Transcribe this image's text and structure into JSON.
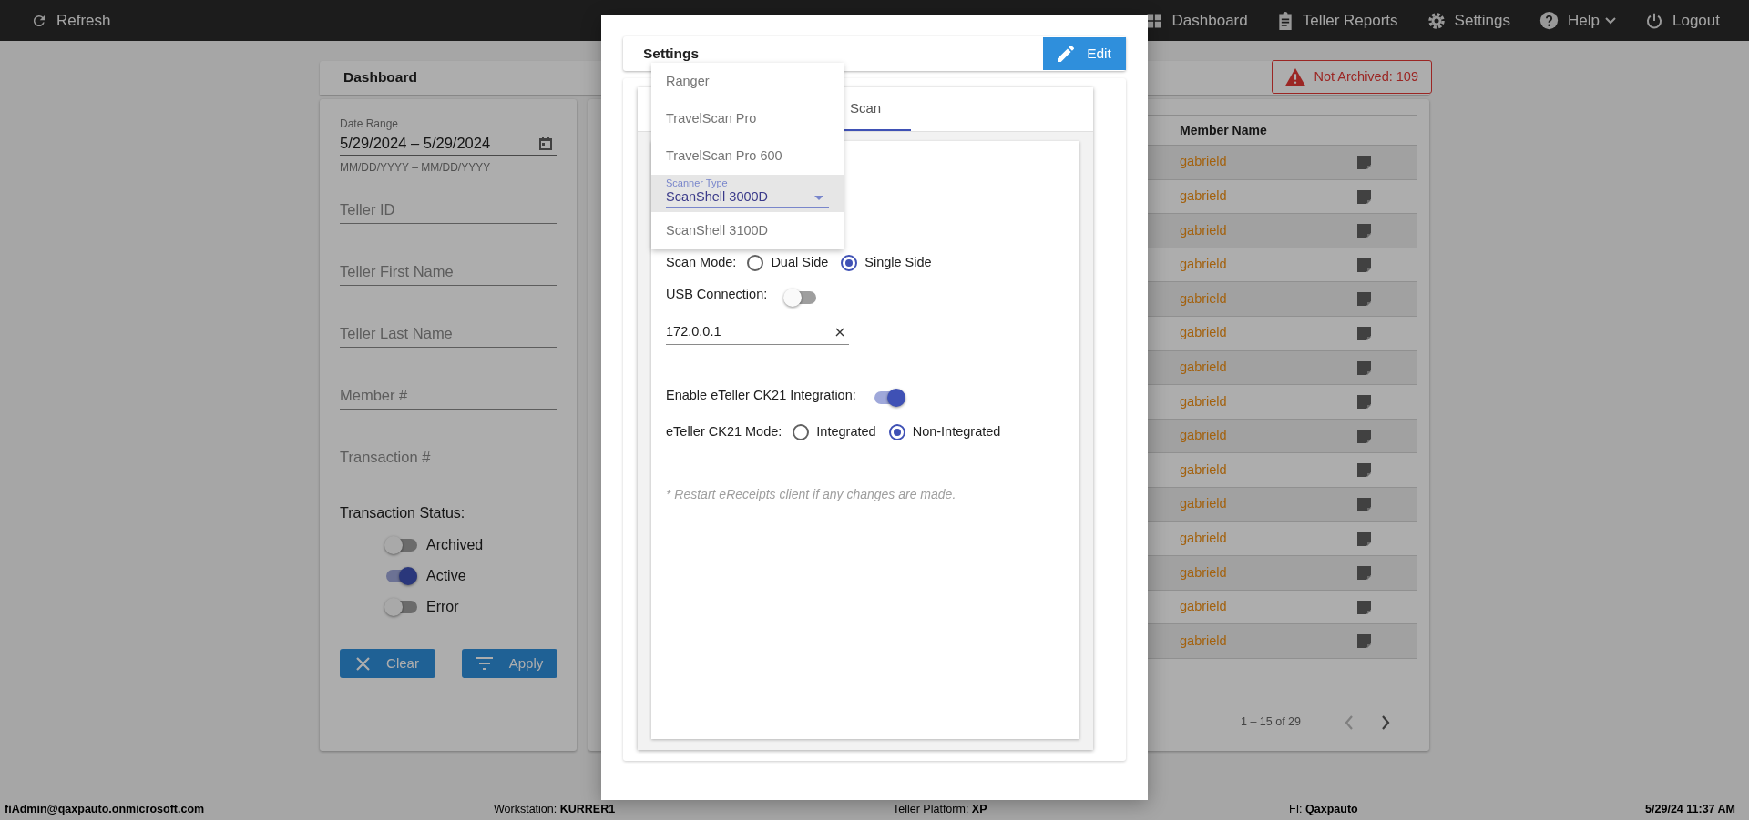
{
  "navbar": {
    "refresh": "Refresh",
    "items": [
      {
        "label": "Dashboard",
        "kind": "link"
      },
      {
        "label": "Teller Reports",
        "kind": "link"
      },
      {
        "label": "Settings",
        "kind": "link"
      },
      {
        "label": "Help",
        "kind": "menu"
      },
      {
        "label": "Logout",
        "kind": "link"
      }
    ]
  },
  "page": {
    "title": "Dashboard",
    "alert": "Not Archived: 109",
    "filters": {
      "date_range": {
        "label": "Date Range",
        "value": "5/29/2024 – 5/29/2024",
        "hint": "MM/DD/YYYY – MM/DD/YYYY"
      },
      "fields": [
        {
          "placeholder": "Teller ID"
        },
        {
          "placeholder": "Teller First Name"
        },
        {
          "placeholder": "Teller Last Name"
        },
        {
          "placeholder": "Member #"
        },
        {
          "placeholder": "Transaction #"
        }
      ],
      "status": {
        "label": "Transaction Status:",
        "toggles": [
          {
            "label": "Archived",
            "on": false
          },
          {
            "label": "Active",
            "on": true
          },
          {
            "label": "Error",
            "on": false
          }
        ]
      },
      "buttons": [
        {
          "label": "Clear",
          "kind": "clear"
        },
        {
          "label": "Apply",
          "kind": "apply"
        }
      ]
    },
    "table": {
      "columns": [
        "Member Name"
      ],
      "rows": [
        {
          "member_name": "gabrield"
        },
        {
          "member_name": "gabrield"
        },
        {
          "member_name": "gabrield"
        },
        {
          "member_name": "gabrield"
        },
        {
          "member_name": "gabrield"
        },
        {
          "member_name": "gabrield"
        },
        {
          "member_name": "gabrield"
        },
        {
          "member_name": "gabrield"
        },
        {
          "member_name": "gabrield"
        },
        {
          "member_name": "gabrield"
        },
        {
          "member_name": "gabrield"
        },
        {
          "member_name": "gabrield"
        },
        {
          "member_name": "gabrield"
        },
        {
          "member_name": "gabrield"
        },
        {
          "member_name": "gabrield"
        }
      ]
    },
    "pagination": {
      "range": "1 – 15 of 29"
    }
  },
  "modal": {
    "title": "Settings",
    "edit": "Edit",
    "tabs": [
      {
        "label": "Scan",
        "selected": true
      }
    ],
    "scanner": {
      "label": "Scanner Type",
      "options": [
        {
          "label": "Ranger",
          "selected": false
        },
        {
          "label": "TravelScan Pro",
          "selected": false
        },
        {
          "label": "TravelScan Pro 600",
          "selected": false
        },
        {
          "label": "ScanShell 3000D",
          "selected": true
        },
        {
          "label": "ScanShell 3100D",
          "selected": false
        }
      ]
    },
    "scan_mode": {
      "label": "Scan Mode:",
      "options": [
        {
          "label": "Dual Side",
          "selected": false
        },
        {
          "label": "Single Side",
          "selected": true
        }
      ]
    },
    "usb": {
      "label": "USB Connection:",
      "on": false
    },
    "host": {
      "value": "172.0.0.1"
    },
    "integration": {
      "label": "Enable eTeller CK21 Integration:",
      "on": true
    },
    "mode": {
      "label": "eTeller CK21 Mode:",
      "options": [
        {
          "label": "Integrated",
          "selected": false
        },
        {
          "label": "Non-Integrated",
          "selected": true
        }
      ]
    },
    "note": "* Restart eReceipts client if any changes are made."
  },
  "footer": {
    "user": "fiAdmin@qaxpauto.onmicrosoft.com",
    "workstation": "Workstation: **KURRER1**",
    "platform": "Teller Platform: **XP**",
    "fi": "FI: **Qaxpauto**",
    "datetime": "5/29/24 11:37 AM"
  }
}
